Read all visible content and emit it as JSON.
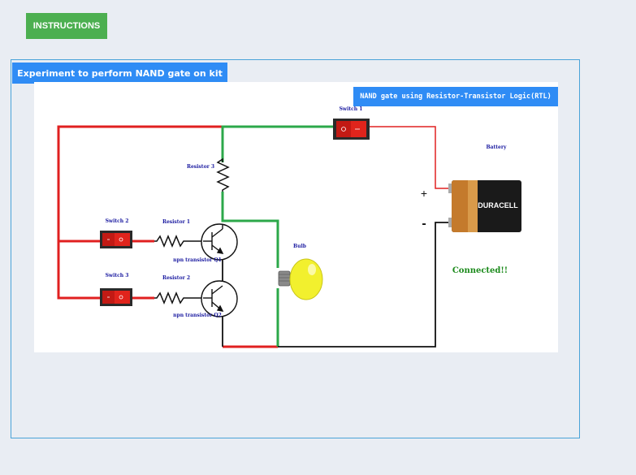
{
  "toolbar": {
    "instructions_label": "INSTRUCTIONS"
  },
  "panel": {
    "title": "Experiment to perform NAND gate on kit"
  },
  "circuit": {
    "title": "NAND gate using Resistor-Transistor Logic(RTL)",
    "labels": {
      "switch1": "Switch 1",
      "switch2": "Switch 2",
      "switch3": "Switch 3",
      "resistor1": "Resistor 1",
      "resistor2": "Resistor 2",
      "resistor3": "Resistor 3",
      "transistor_q1": "npn transistor Q1",
      "transistor_q2": "npn transistor Q2",
      "bulb": "Bulb",
      "battery": "Battery",
      "battery_brand": "DURACELL",
      "battery_plus": "+",
      "battery_minus": "-"
    },
    "status": "Connected!!",
    "colors": {
      "wire_red": "#e02020",
      "wire_green": "#2ca84a",
      "wire_black": "#111111",
      "accent": "#2f8cf5",
      "status": "#1b8a1b"
    }
  }
}
